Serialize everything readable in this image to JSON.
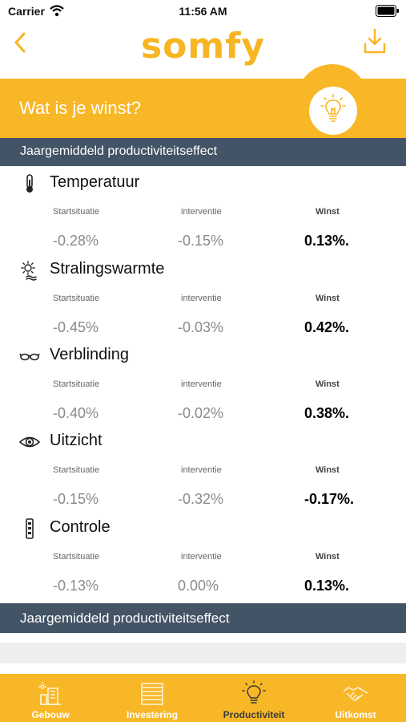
{
  "status_bar": {
    "carrier": "Carrier",
    "time": "11:56 AM"
  },
  "header": {
    "logo_text": "somfy",
    "brand_color": "#f7b522"
  },
  "hero": {
    "title": "Wat is je winst?",
    "icon": "lightbulb-icon"
  },
  "section_title": "Jaargemiddeld productiviteitseffect",
  "columns": {
    "start": "Startsituatie",
    "intervention": "interventie",
    "win": "Winst"
  },
  "metrics": [
    {
      "name": "Temperatuur",
      "icon": "thermometer-icon",
      "start": "-0.28%",
      "intervention": "-0.15%",
      "win": "0.13%."
    },
    {
      "name": "Stralingswarmte",
      "icon": "sun-heat-icon",
      "start": "-0.45%",
      "intervention": "-0.03%",
      "win": "0.42%."
    },
    {
      "name": "Verblinding",
      "icon": "glasses-icon",
      "start": "-0.40%",
      "intervention": "-0.02%",
      "win": "0.38%."
    },
    {
      "name": "Uitzicht",
      "icon": "eye-icon",
      "start": "-0.15%",
      "intervention": "-0.32%",
      "win": "-0.17%."
    },
    {
      "name": "Controle",
      "icon": "remote-control-icon",
      "start": "-0.13%",
      "intervention": "0.00%",
      "win": "0.13%."
    }
  ],
  "footer_section_title": "Jaargemiddeld productiviteitseffect",
  "tabs": [
    {
      "label": "Gebouw",
      "icon": "building-icon",
      "active": false
    },
    {
      "label": "Investering",
      "icon": "blinds-icon",
      "active": false
    },
    {
      "label": "Productiviteit",
      "icon": "lightbulb-icon",
      "active": true
    },
    {
      "label": "Uitkomst",
      "icon": "handshake-icon",
      "active": false
    }
  ],
  "colors": {
    "accent": "#f8b726",
    "section_bar": "#435466",
    "active_tab_text": "#3a3a3a"
  }
}
